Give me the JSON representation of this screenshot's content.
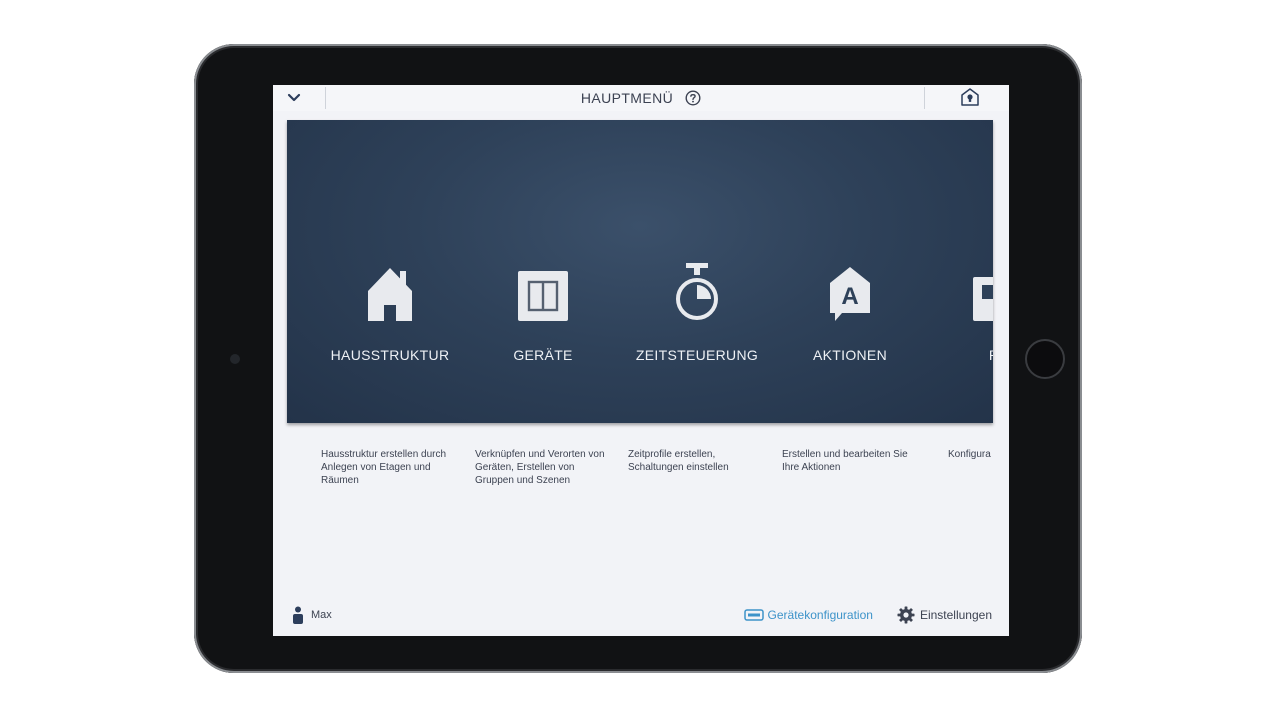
{
  "header": {
    "title": "HAUPTMENÜ"
  },
  "menu": {
    "tiles": [
      {
        "label": "HAUSSTRUKTUR",
        "icon": "house-icon",
        "description": "Hausstruktur erstellen durch Anlegen von Etagen und Räumen"
      },
      {
        "label": "GERÄTE",
        "icon": "device-switch-icon",
        "description": "Verknüpfen und Verorten von Geräten, Erstellen von Gruppen und Szenen"
      },
      {
        "label": "ZEITSTEUERUNG",
        "icon": "stopwatch-icon",
        "description": "Zeitprofile erstellen, Schaltungen einstellen"
      },
      {
        "label": "AKTIONEN",
        "icon": "action-icon",
        "description": "Erstellen und bearbeiten Sie Ihre Aktionen"
      },
      {
        "label": "PA",
        "icon": "panel-icon",
        "description": "Konfigura"
      }
    ]
  },
  "footer": {
    "user": "Max",
    "device_config": "Gerätekonfiguration",
    "settings": "Einstellungen"
  },
  "colors": {
    "panel_dark": "#2e4159",
    "accent_link": "#3d93c9",
    "text_dark": "#3d4352",
    "icon_light": "#e8eaee"
  }
}
